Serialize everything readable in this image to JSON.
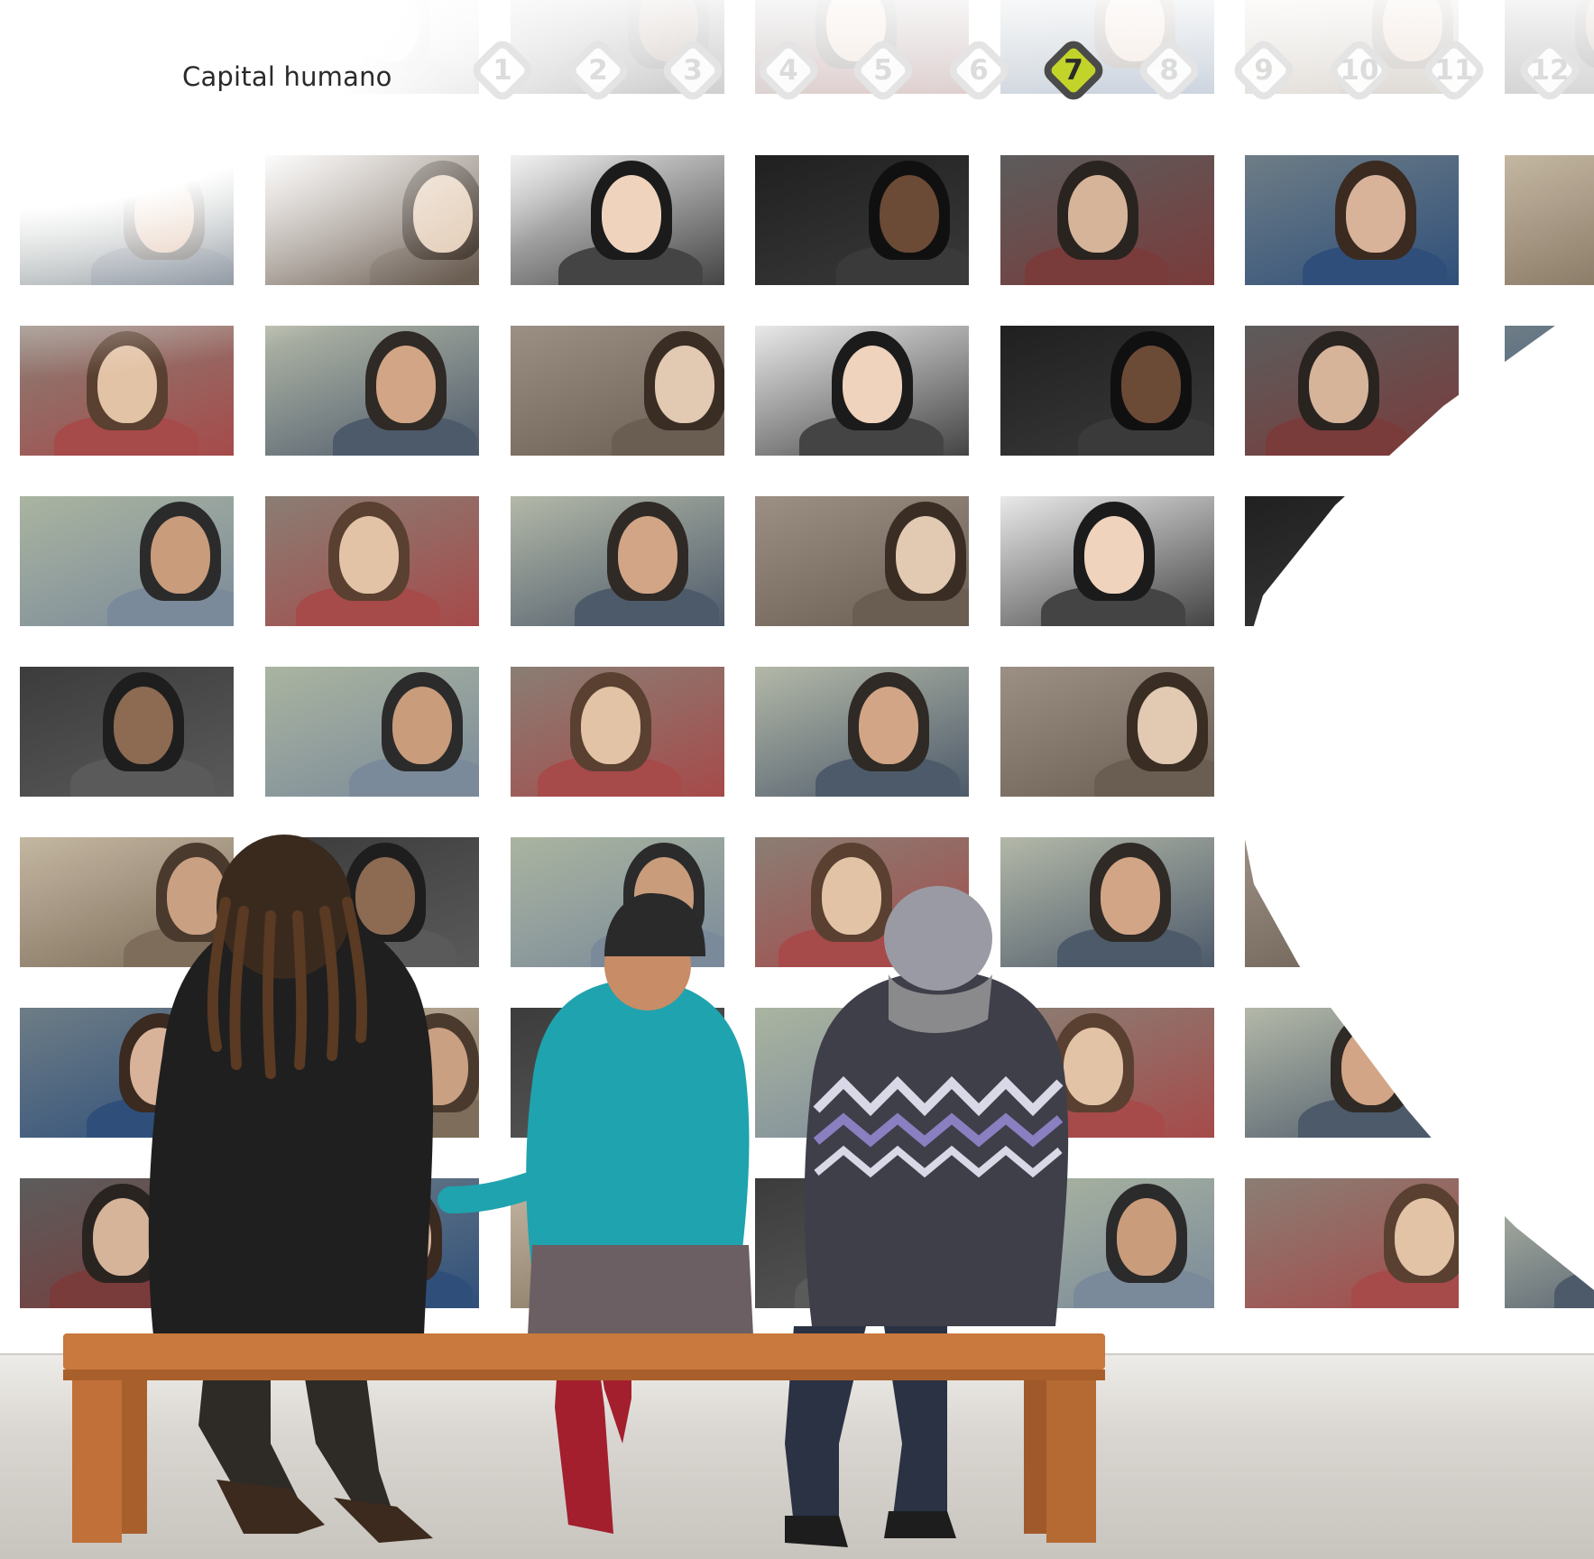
{
  "header": {
    "title": "Capital humano"
  },
  "steps": [
    {
      "label": "1",
      "active": false
    },
    {
      "label": "2",
      "active": false
    },
    {
      "label": "3",
      "active": false
    },
    {
      "label": "4",
      "active": false
    },
    {
      "label": "5",
      "active": false
    },
    {
      "label": "6",
      "active": false
    },
    {
      "label": "7",
      "active": true
    },
    {
      "label": "8",
      "active": false
    },
    {
      "label": "9",
      "active": false
    },
    {
      "label": "10",
      "active": false
    },
    {
      "label": "11",
      "active": false
    },
    {
      "label": "12",
      "active": false
    }
  ],
  "colors": {
    "active_step_fill": "#c2d42a",
    "active_step_border": "#4a4a4a",
    "inactive_step_border": "#e4e4e4",
    "inactive_step_text": "#dcdcdc",
    "title_text": "#2a2a2a"
  },
  "photo_wall": {
    "rows": 8,
    "columns": 7,
    "description_icon": "portrait-photo"
  }
}
